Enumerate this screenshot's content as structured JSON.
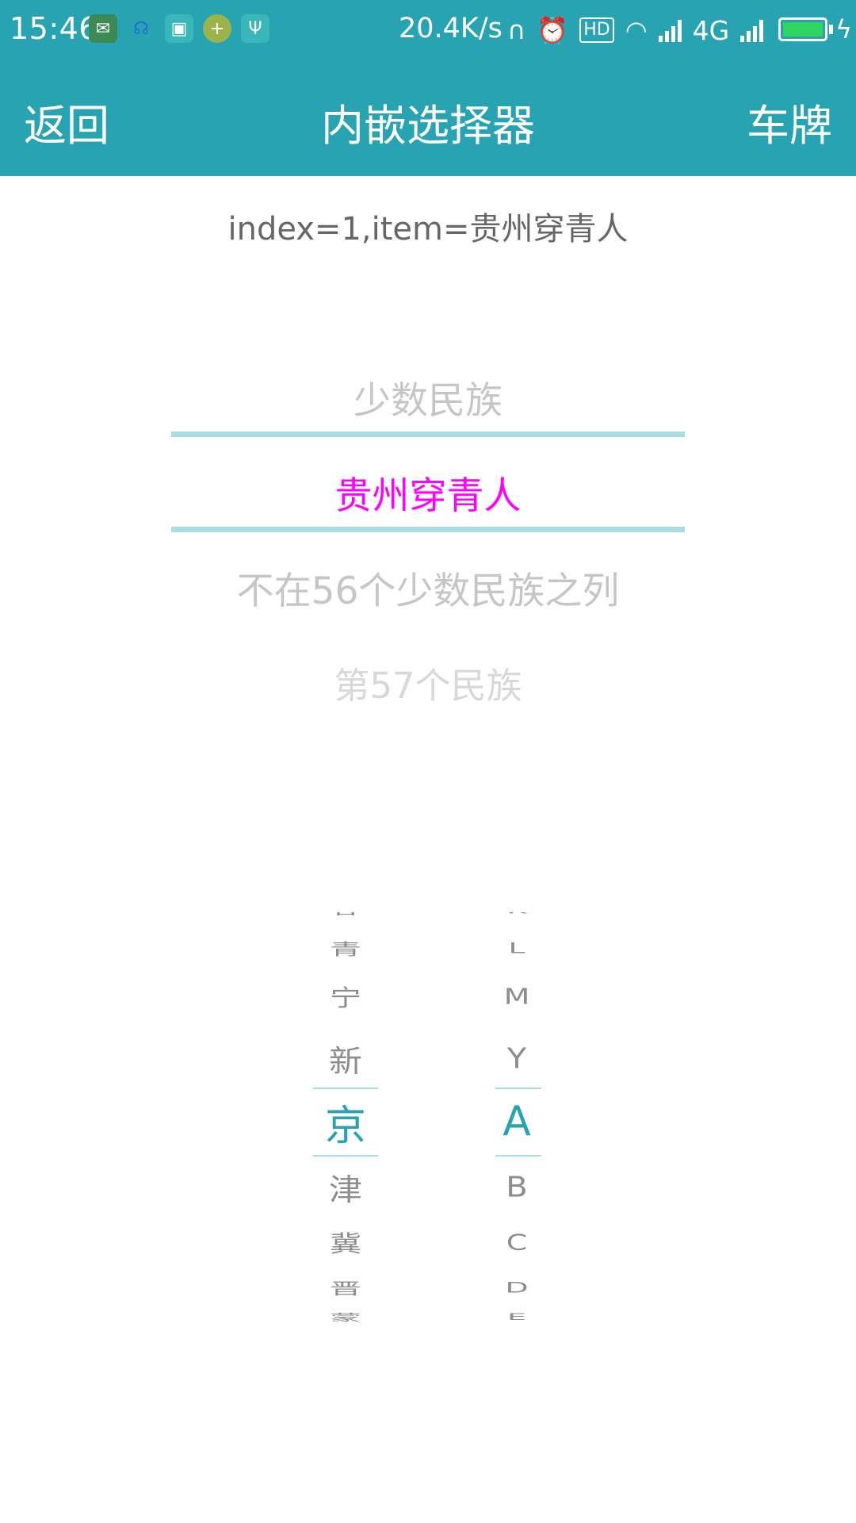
{
  "status_bar": {
    "time": "15:46",
    "net_speed": "20.4K/s",
    "network_type": "4G",
    "app_icons": [
      {
        "name": "wechat-icon",
        "glyph": "✉",
        "color": "#3b8a55"
      },
      {
        "name": "support-icon",
        "glyph": "☊",
        "color": "#27a3b2"
      },
      {
        "name": "scan-icon",
        "glyph": "▣",
        "color": "#38b6b8"
      },
      {
        "name": "plus-icon",
        "glyph": "+",
        "color": "#9bb34a"
      },
      {
        "name": "usb-icon",
        "glyph": "Ψ",
        "color": "#38b6b8"
      }
    ],
    "battery_color": "#2fd461"
  },
  "toolbar": {
    "back_label": "返回",
    "title": "内嵌选择器",
    "right_label": "车牌",
    "background": "#27a3b2"
  },
  "result_text": "index=1,item=贵州穿青人",
  "wheel": {
    "items": [
      {
        "label": "少数民族",
        "state": "normal"
      },
      {
        "label": "贵州穿青人",
        "state": "selected"
      },
      {
        "label": "不在56个少数民族之列",
        "state": "normal"
      },
      {
        "label": "第57个民族",
        "state": "far"
      }
    ],
    "selected_index": 1,
    "selected_color": "#ff00ff",
    "divider_color": "#a8dde2"
  },
  "plate_picker": {
    "provinces": [
      "青",
      "宁",
      "新",
      "京",
      "津",
      "冀",
      "晋"
    ],
    "letters": [
      "L",
      "M",
      "Y",
      "A",
      "B",
      "C",
      "D"
    ],
    "selected_province": "京",
    "selected_letter": "A",
    "selected_color": "#27a3b2"
  }
}
